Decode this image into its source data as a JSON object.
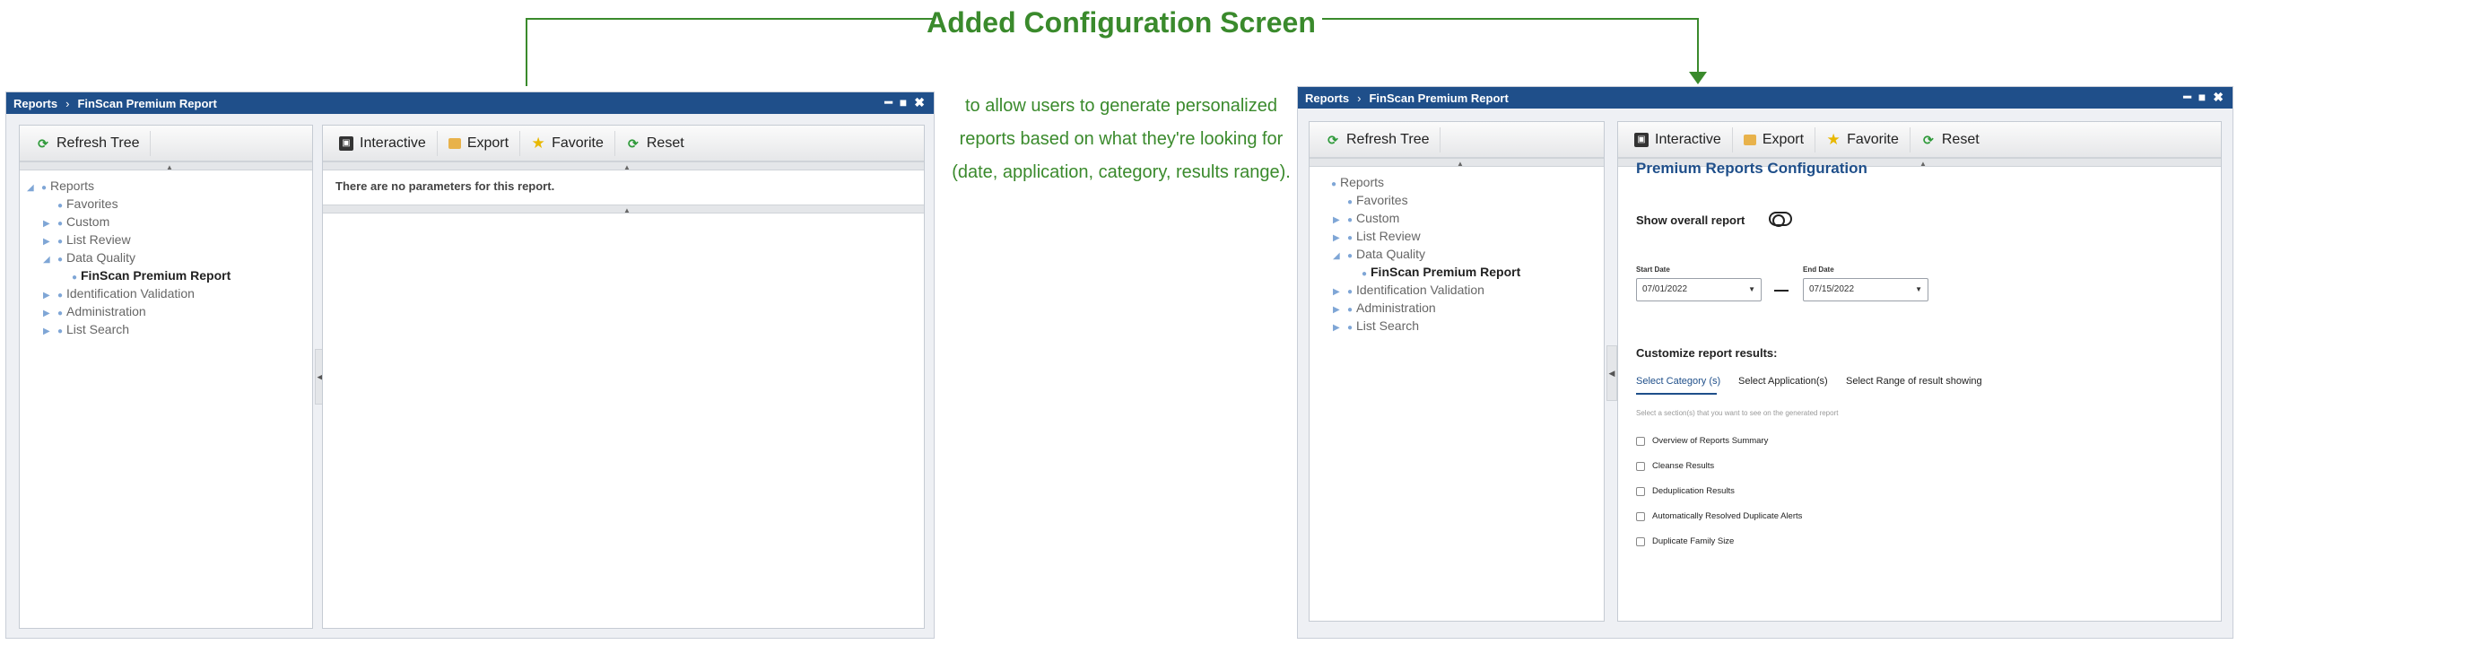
{
  "annotation": {
    "title": "Added Configuration Screen",
    "body": "to allow users to generate personalized reports based on what they're looking for (date, application, category, results range)."
  },
  "colors": {
    "accent": "#3a8a2c",
    "titlebar": "#1f4f8a"
  },
  "left_window": {
    "breadcrumb": [
      "Reports",
      "FinScan Premium Report"
    ],
    "tree_toolbar": {
      "refresh_label": "Refresh Tree",
      "icon": "refresh-icon"
    },
    "main_toolbar": [
      {
        "label": "Interactive",
        "icon": "interactive-icon"
      },
      {
        "label": "Export",
        "icon": "export-icon"
      },
      {
        "label": "Favorite",
        "icon": "star-icon"
      },
      {
        "label": "Reset",
        "icon": "reset-icon"
      }
    ],
    "tree": [
      {
        "label": "Reports",
        "level": 0,
        "expanded": true
      },
      {
        "label": "Favorites",
        "level": 1
      },
      {
        "label": "Custom",
        "level": 1,
        "collapsed": true
      },
      {
        "label": "List Review",
        "level": 1,
        "collapsed": true
      },
      {
        "label": "Data Quality",
        "level": 1,
        "expanded": true
      },
      {
        "label": "FinScan Premium Report",
        "level": 2,
        "selected": true
      },
      {
        "label": "Identification Validation",
        "level": 1,
        "collapsed": true
      },
      {
        "label": "Administration",
        "level": 1,
        "collapsed": true
      },
      {
        "label": "List Search",
        "level": 1,
        "collapsed": true
      }
    ],
    "no_params_text": "There are no parameters for this report."
  },
  "right_window": {
    "breadcrumb": [
      "Reports",
      "FinScan Premium Report"
    ],
    "tree_toolbar": {
      "refresh_label": "Refresh Tree"
    },
    "main_toolbar": [
      "Interactive",
      "Export",
      "Favorite",
      "Reset"
    ],
    "tree": [
      {
        "label": "Reports",
        "level": 0
      },
      {
        "label": "Favorites",
        "level": 1
      },
      {
        "label": "Custom",
        "level": 1,
        "collapsed": true
      },
      {
        "label": "List Review",
        "level": 1,
        "collapsed": true
      },
      {
        "label": "Data Quality",
        "level": 1,
        "expanded": true
      },
      {
        "label": "FinScan Premium Report",
        "level": 2,
        "selected": true
      },
      {
        "label": "Identification Validation",
        "level": 1,
        "collapsed": true
      },
      {
        "label": "Administration",
        "level": 1,
        "collapsed": true
      },
      {
        "label": "List Search",
        "level": 1,
        "collapsed": true
      }
    ],
    "config": {
      "title": "Premium Reports Configuration",
      "show_overall_label": "Show overall report",
      "start_date_label": "Start Date",
      "start_date_value": "07/01/2022",
      "end_date_label": "End Date",
      "end_date_value": "07/15/2022",
      "customize_label": "Customize report results:",
      "tabs": [
        "Select Category (s)",
        "Select Application(s)",
        "Select Range of result showing"
      ],
      "hint": "Select a section(s) that you want to see on the generated report",
      "checkboxes": [
        "Overview of Reports Summary",
        "Cleanse Results",
        "Deduplication Results",
        "Automatically Resolved Duplicate Alerts",
        "Duplicate Family Size"
      ]
    }
  }
}
